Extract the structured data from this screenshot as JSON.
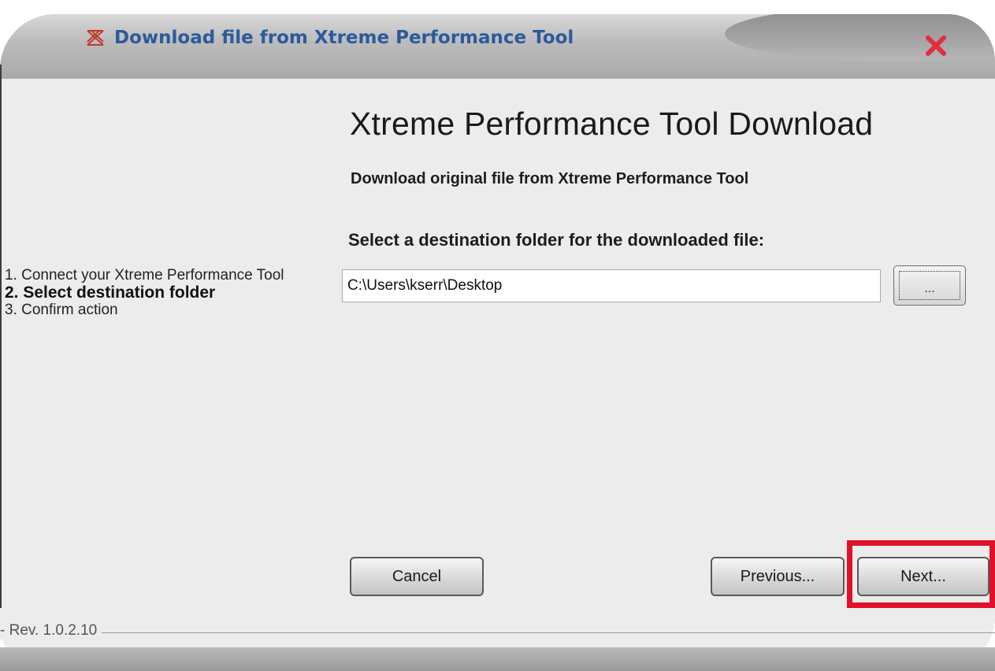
{
  "window": {
    "title": "Download file from Xtreme Performance Tool",
    "app_icon": "xpt-logo-icon",
    "close_icon": "close-icon"
  },
  "steps": [
    {
      "label": "1. Connect your Xtreme Performance Tool",
      "active": false
    },
    {
      "label": "2. Select destination folder",
      "active": true
    },
    {
      "label": "3. Confirm action",
      "active": false
    }
  ],
  "main": {
    "heading": "Xtreme Performance Tool Download",
    "subheading": "Download original file from Xtreme Performance Tool",
    "folder_label": "Select a destination folder for the downloaded file:",
    "folder_path": "C:\\Users\\kserr\\Desktop",
    "browse_label": "..."
  },
  "buttons": {
    "cancel": "Cancel",
    "previous": "Previous...",
    "next": "Next..."
  },
  "footer": {
    "revision": "- Rev. 1.0.2.10"
  },
  "colors": {
    "title_text": "#2c5a9c",
    "close_x": "#e03040",
    "highlight": "#e0102a"
  }
}
